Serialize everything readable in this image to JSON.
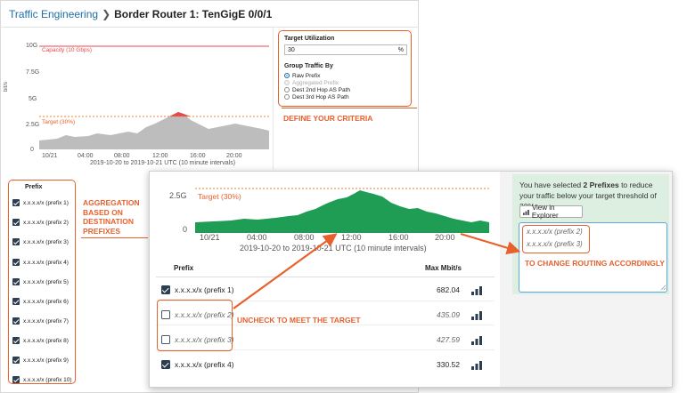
{
  "breadcrumb": {
    "root": "Traffic Engineering",
    "current": "Border Router 1: TenGigE 0/0/1"
  },
  "back_chart": {
    "y_ticks": [
      "10G",
      "7.5G",
      "5G",
      "2.5G",
      "0"
    ],
    "y_unit": "bit/s",
    "x_ticks": [
      "10/21",
      "04:00",
      "08:00",
      "12:00",
      "16:00",
      "20:00"
    ],
    "x_caption": "2019-10-20 to 2019-10-21 UTC (10 minute intervals)",
    "capacity_label": "Capacity (10 Gbps)",
    "target_label": "Target (30%)"
  },
  "criteria": {
    "utilization_label": "Target Utilization",
    "utilization_value": "30",
    "utilization_unit": "%",
    "group_label": "Group Traffic By",
    "options": [
      {
        "label": "Raw Prefix",
        "state": "selected"
      },
      {
        "label": "Aggregated Prefix",
        "state": "disabled"
      },
      {
        "label": "Dest 2nd Hop AS Path",
        "state": "normal"
      },
      {
        "label": "Dest 3rd Hop AS Path",
        "state": "normal"
      }
    ]
  },
  "annotations": {
    "define": "DEFINE YOUR CRITERIA",
    "aggregation": [
      "AGGREGATION",
      "BASED ON",
      "DESTINATION",
      "PREFIXES"
    ],
    "uncheck": "UNCHECK TO MEET THE TARGET",
    "change_routing": "TO CHANGE ROUTING ACCORDINGLY"
  },
  "left_list": {
    "header": "Prefix",
    "items": [
      "x.x.x.x/x (prefix 1)",
      "x.x.x.x/x (prefix 2)",
      "x.x.x.x/x (prefix 3)",
      "x.x.x.x/x (prefix 4)",
      "x.x.x.x/x (prefix 5)",
      "x.x.x.x/x (prefix 6)",
      "x.x.x.x/x (prefix 7)",
      "x.x.x.x/x (prefix 8)",
      "x.x.x.x/x (prefix 9)",
      "x.x.x.x/x (prefix 10)"
    ]
  },
  "front_chart": {
    "y_ticks": [
      "2.5G",
      "0"
    ],
    "x_ticks": [
      "10/21",
      "04:00",
      "08:00",
      "12:00",
      "16:00",
      "20:00"
    ],
    "x_caption": "2019-10-20 to 2019-10-21 UTC (10 minute intervals)",
    "target_label": "Target (30%)"
  },
  "table": {
    "col_prefix": "Prefix",
    "col_max": "Max Mbit/s",
    "rows": [
      {
        "prefix": "x.x.x.x/x (prefix 1)",
        "value": "682.04",
        "checked": true
      },
      {
        "prefix": "x.x.x.x/x (prefix 2)",
        "value": "435.09",
        "checked": false
      },
      {
        "prefix": "x.x.x.x/x (prefix 3)",
        "value": "427.59",
        "checked": false
      },
      {
        "prefix": "x.x.x.x/x (prefix 4)",
        "value": "330.52",
        "checked": true
      }
    ]
  },
  "selection": {
    "pre": "You have selected ",
    "count": "2 Prefixes",
    "post": " to reduce your traffic below your target threshold of 30%",
    "button": "View in Explorer",
    "selected": [
      "x.x.x.x/x (prefix 2)",
      "x.x.x.x/x (prefix 3)"
    ]
  },
  "colors": {
    "accent": "#e8602c",
    "capacity": "#e5484d",
    "area": "#bdbdbd",
    "area_over": "#e5484d",
    "front_area": "#1f9d55",
    "link": "#1d6fa5"
  }
}
